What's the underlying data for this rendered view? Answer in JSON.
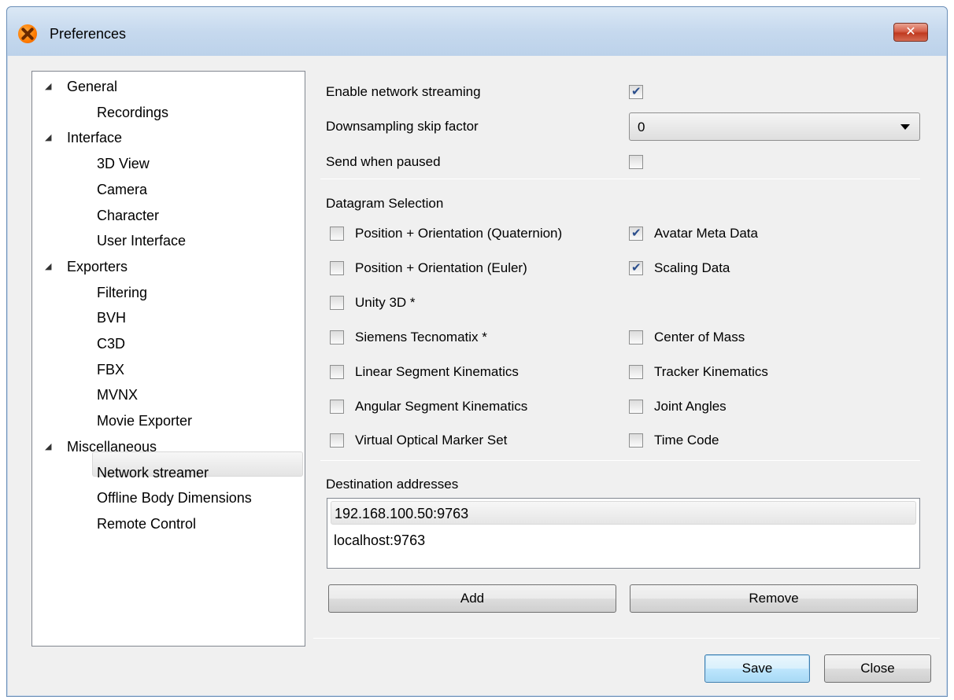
{
  "window": {
    "title": "Preferences",
    "close_glyph": "✕"
  },
  "tree": {
    "arrow_glyph": "◢",
    "items": [
      {
        "label": "General",
        "level": 0
      },
      {
        "label": "Recordings",
        "level": 1
      },
      {
        "label": "Interface",
        "level": 0
      },
      {
        "label": "3D View",
        "level": 1
      },
      {
        "label": "Camera",
        "level": 1
      },
      {
        "label": "Character",
        "level": 1
      },
      {
        "label": "User Interface",
        "level": 1
      },
      {
        "label": "Exporters",
        "level": 0
      },
      {
        "label": "Filtering",
        "level": 1
      },
      {
        "label": "BVH",
        "level": 1
      },
      {
        "label": "C3D",
        "level": 1
      },
      {
        "label": "FBX",
        "level": 1
      },
      {
        "label": "MVNX",
        "level": 1
      },
      {
        "label": "Movie Exporter",
        "level": 1
      },
      {
        "label": "Miscellaneous",
        "level": 0
      },
      {
        "label": "Network streamer",
        "level": 1,
        "selected": true
      },
      {
        "label": "Offline Body Dimensions",
        "level": 1
      },
      {
        "label": "Remote Control",
        "level": 1
      }
    ]
  },
  "settings": {
    "enable_streaming": {
      "label": "Enable network streaming",
      "checked": true
    },
    "downsampling": {
      "label": "Downsampling skip factor",
      "value": "0"
    },
    "send_paused": {
      "label": "Send when paused",
      "checked": false
    }
  },
  "datagram": {
    "heading": "Datagram Selection",
    "left": [
      {
        "label": "Position + Orientation (Quaternion)",
        "checked": false
      },
      {
        "label": "Position + Orientation (Euler)",
        "checked": false
      },
      {
        "label": "Unity 3D *",
        "checked": false
      },
      {
        "label": "Siemens Tecnomatix *",
        "checked": false
      },
      {
        "label": "Linear Segment Kinematics",
        "checked": false
      },
      {
        "label": "Angular Segment Kinematics",
        "checked": false
      },
      {
        "label": "Virtual Optical Marker Set",
        "checked": false
      }
    ],
    "right": [
      {
        "label": "Avatar Meta Data",
        "checked": true
      },
      {
        "label": "Scaling Data",
        "checked": true
      },
      null,
      {
        "label": "Center of Mass",
        "checked": false
      },
      {
        "label": "Tracker Kinematics",
        "checked": false
      },
      {
        "label": "Joint Angles",
        "checked": false
      },
      {
        "label": "Time Code",
        "checked": false
      }
    ]
  },
  "destinations": {
    "heading": "Destination addresses",
    "items": [
      "192.168.100.50:9763",
      "localhost:9763"
    ],
    "add_label": "Add",
    "remove_label": "Remove"
  },
  "footer": {
    "save_label": "Save",
    "close_label": "Close"
  }
}
